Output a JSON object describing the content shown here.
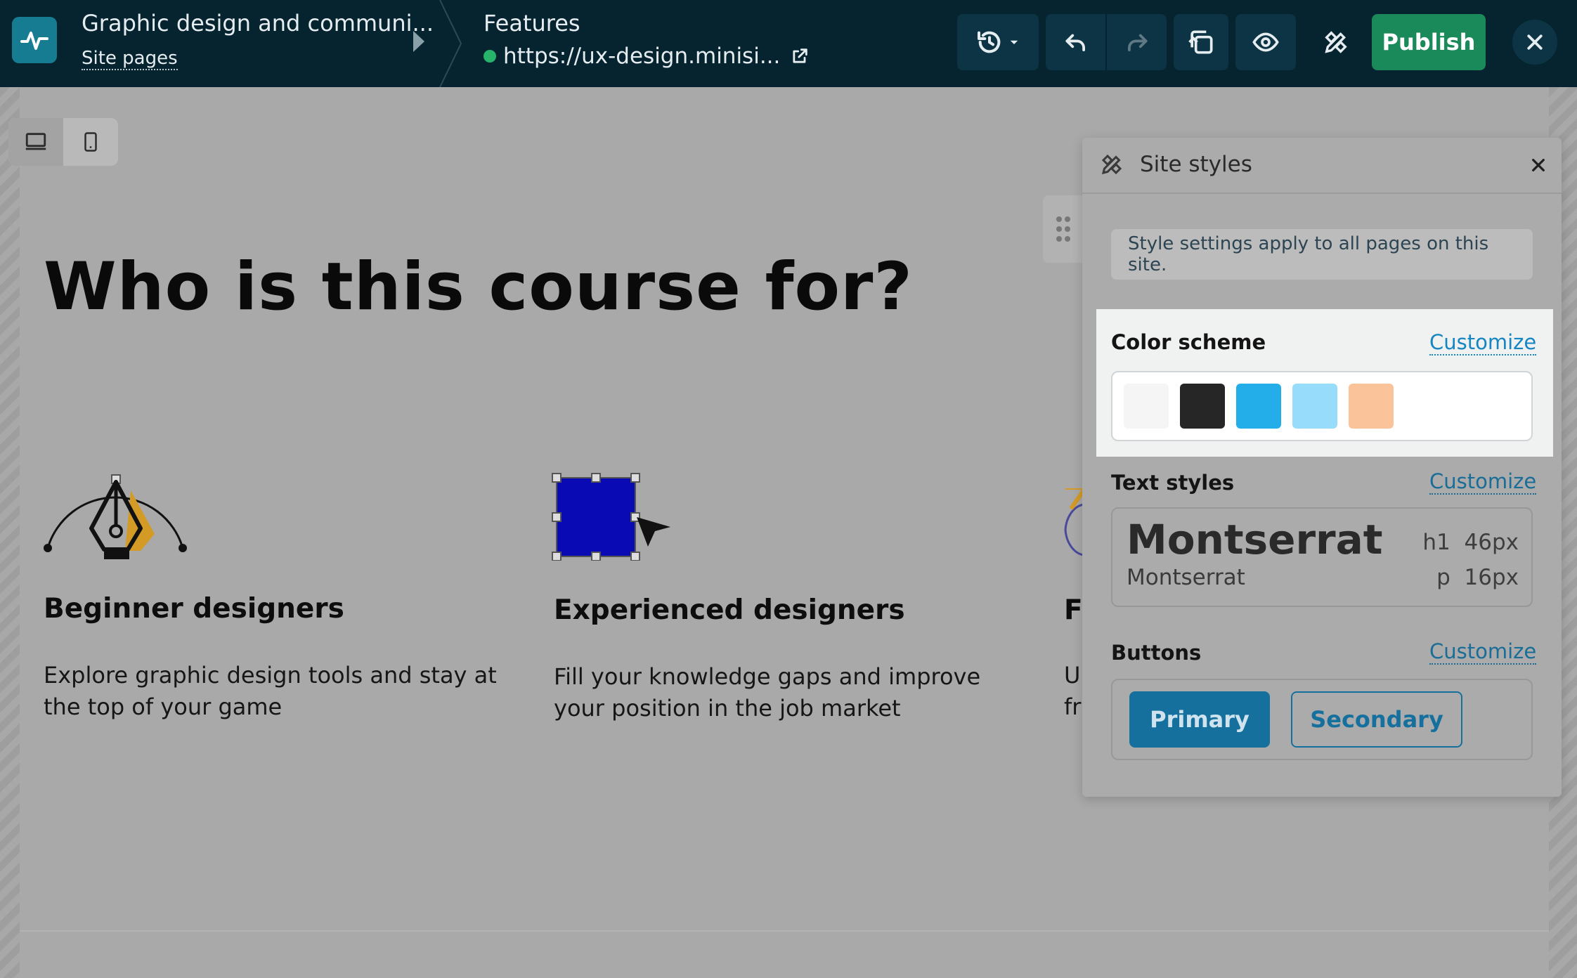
{
  "topbar": {
    "site_title": "Graphic design and communi...",
    "site_pages_link": "Site pages",
    "page_name": "Features",
    "page_url": "https://ux-design.minisi...",
    "publish_label": "Publish",
    "icons": {
      "logo": "pulse-logo-icon",
      "history": "history-icon",
      "undo": "undo-icon",
      "redo": "redo-icon",
      "pages": "pages-icon",
      "preview": "eye-icon",
      "styles": "design-tools-icon",
      "close": "close-icon"
    }
  },
  "canvas": {
    "device_toggle": [
      "desktop-icon",
      "mobile-icon"
    ],
    "heading": "Who is this course for?",
    "cards": [
      {
        "title": "Beginner designers",
        "text": "Explore graphic design tools and stay at the top of your game"
      },
      {
        "title": "Experienced designers",
        "text": "Fill your knowledge gaps and improve your position in the job market"
      },
      {
        "title": "F",
        "text_line1": "U",
        "text_line2": "fr"
      }
    ]
  },
  "site_styles_panel": {
    "title": "Site styles",
    "notice": "Style settings apply to all pages on this site.",
    "color_scheme": {
      "label": "Color scheme",
      "customize": "Customize",
      "swatches": [
        "#f5f5f5",
        "#262626",
        "#24aee9",
        "#97dcfb",
        "#fbc39a"
      ]
    },
    "text_styles": {
      "label": "Text styles",
      "customize": "Customize",
      "h1_font": "Montserrat",
      "h1_tag": "h1",
      "h1_size": "46px",
      "p_font": "Montserrat",
      "p_tag": "p",
      "p_size": "16px"
    },
    "buttons": {
      "label": "Buttons",
      "customize": "Customize",
      "primary": "Primary",
      "secondary": "Secondary"
    }
  },
  "colors": {
    "topbar_bg": "#062430",
    "publish_green": "#1b8a5a",
    "accent_blue": "#1686c2"
  }
}
